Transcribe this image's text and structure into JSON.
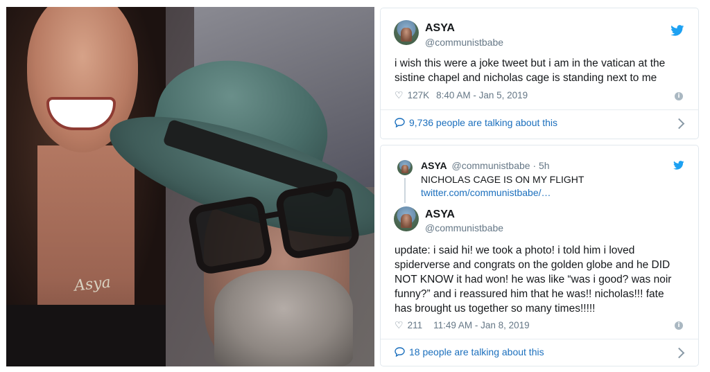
{
  "photo": {
    "necklace_text": "Asya"
  },
  "tweet1": {
    "name": "ASYA",
    "handle": "@communistbabe",
    "text_line1": "i wish this were a joke tweet but i am in the vatican at the",
    "text_line2": "sistine chapel and nicholas cage is standing next to me",
    "likes": "127K",
    "timestamp": "8:40 AM - Jan 5, 2019",
    "talking": "9,736 people are talking about this"
  },
  "tweet2": {
    "reply_to": {
      "name": "ASYA",
      "handle": "@communistbabe · 5h",
      "text": "NICHOLAS CAGE IS ON MY FLIGHT",
      "link": "twitter.com/communistbabe/…"
    },
    "name": "ASYA",
    "handle": "@communistbabe",
    "lines": [
      "update: i said hi! we took a photo! i told him i loved",
      "spiderverse and congrats on the golden globe and he DID",
      "NOT KNOW it had won! he was like “was i good? was noir",
      "funny?” and i reassured him that he was!! nicholas!!! fate",
      "has brought us together so many times!!!!!"
    ],
    "likes": "211",
    "timestamp": "11:49 AM - Jan 8, 2019",
    "talking": "18 people are talking about this"
  },
  "colors": {
    "twitter_blue": "#1da1f2",
    "link_blue": "#1b6fbd",
    "secondary_text": "#657786"
  }
}
